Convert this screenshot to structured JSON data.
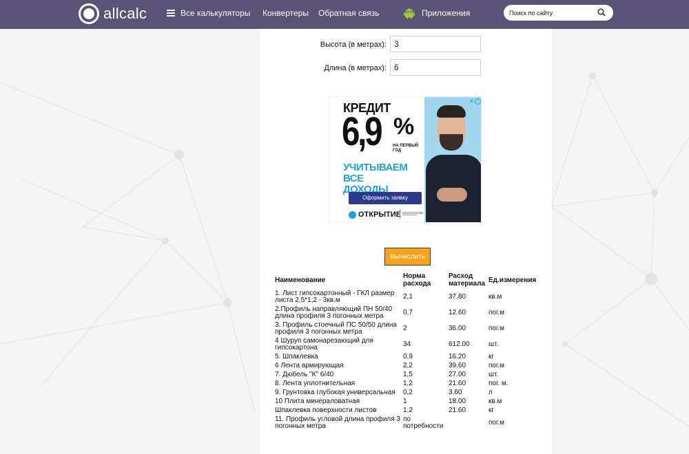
{
  "header": {
    "logo_text": "allcalc",
    "nav_all": "Все калькуляторы",
    "nav_converters": "Конвертеры",
    "nav_feedback": "Обратная связь",
    "nav_apps": "Приложения",
    "search_placeholder": "Поиск по сайту"
  },
  "form": {
    "height_label": "Высота (в метрах):",
    "height_value": "3",
    "length_label": "Длина (в метрах):",
    "length_value": "6"
  },
  "ad": {
    "headline": "КРЕДИТ",
    "rate": "6,9",
    "percent": "%",
    "first_year": "НА ПЕРВЫЙ ГОД",
    "slogan_line1": "УЧИТЫВАЕМ ВСЕ",
    "slogan_line2": "ДОХОДЫ",
    "cta": "Оформить заявку",
    "bank": "ОТКРЫТИЕ"
  },
  "calc_button": "Вычислить",
  "table": {
    "headers": [
      "Наименование",
      "Норма расхода",
      "Расход материала",
      "Ед.измерения"
    ],
    "rows": [
      [
        "1. Лист гипсокартонный - ГКЛ размер листа 2,5*1,2 - 3кв.м",
        "2,1",
        "37.80",
        "кв.м"
      ],
      [
        "2.Профиль направляющий ПН 50/40 длина профиля 3 погонных метра",
        "0,7",
        "12.60",
        "пог.м"
      ],
      [
        "3. Профиль стоечный ПС 50/50 длина профиля 3 погонных метра",
        "2",
        "36.00",
        "пог.м"
      ],
      [
        "4 Шуруп самонарезающий для гипсокартона",
        "34",
        "612.00",
        "шт."
      ],
      [
        "5. Шпаклевка",
        "0,9",
        "16.20",
        "кг"
      ],
      [
        "6 Лента армирующая",
        "2,2",
        "39.60",
        "пог.м"
      ],
      [
        "7. Дюбель \"К\" 6/40",
        "1,5",
        "27.00",
        "шт."
      ],
      [
        "8. Лента уплотнительная",
        "1,2",
        "21.60",
        "пог. м."
      ],
      [
        "9. Грунтовка глубокая универсальная",
        "0,2",
        "3.60",
        "л"
      ],
      [
        "10 Плита минераловатная",
        "1",
        "18.00",
        "кв.м"
      ],
      [
        "Шпаклевка поверхности листов",
        "1,2",
        "21.60",
        "кг"
      ],
      [
        "11. Профиль угловой длина профиля 3 погонных метра",
        "по потребности",
        "",
        "пог.м"
      ]
    ]
  },
  "colors": {
    "header_bg": "#5a5277",
    "button_bg": "#f9a31a",
    "ad_accent": "#1ea2d8",
    "ad_button": "#2b3a8c"
  }
}
